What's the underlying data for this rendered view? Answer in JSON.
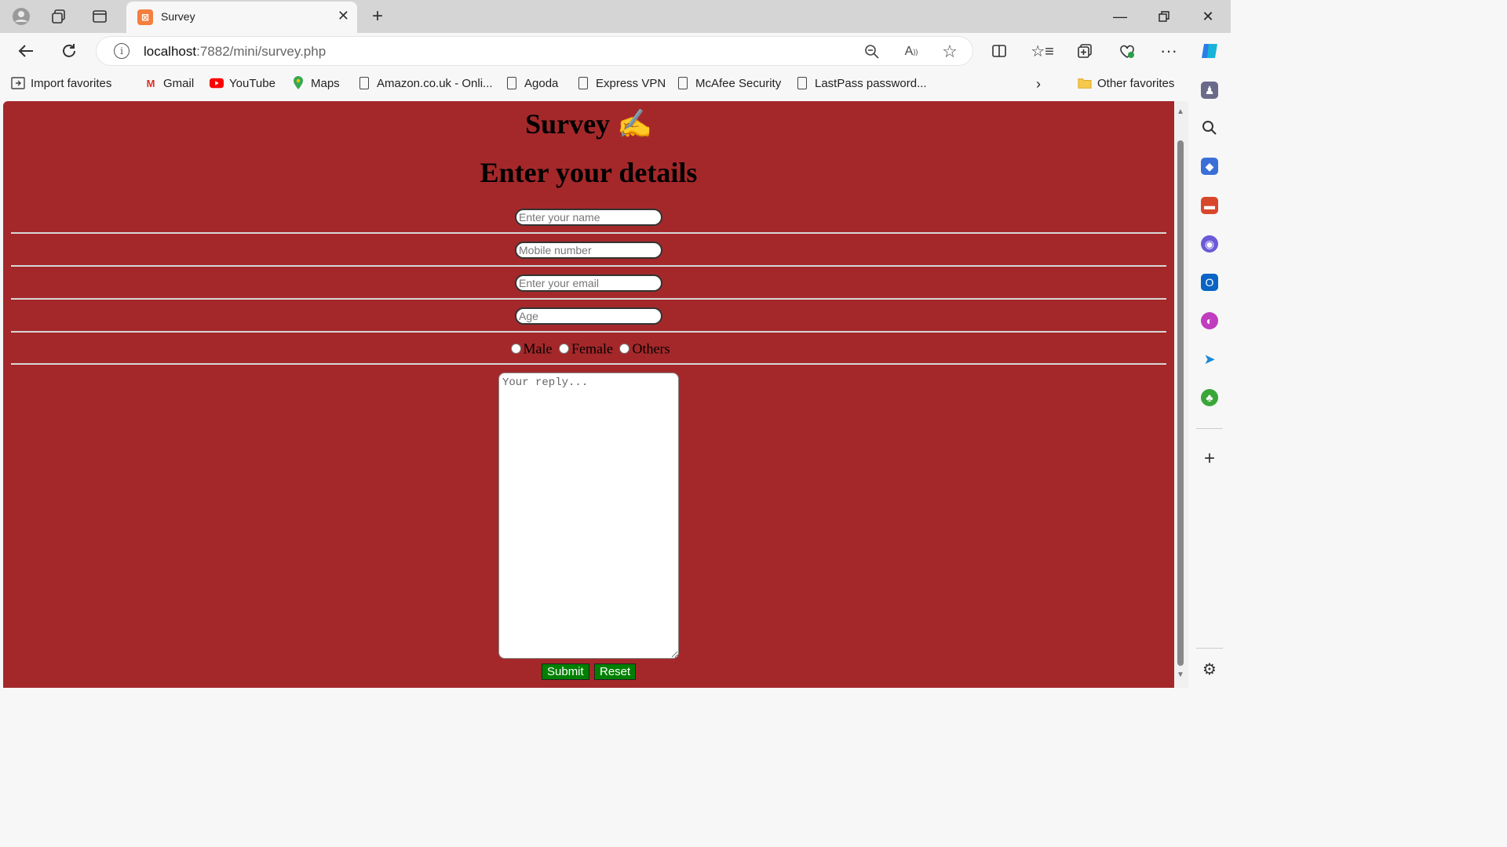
{
  "browser": {
    "tab": {
      "title": "Survey"
    },
    "address": {
      "host": "localhost",
      "rest": ":7882/mini/survey.php"
    },
    "favorites": [
      {
        "label": "Import favorites",
        "icon": "import-favorites-icon"
      },
      {
        "label": "Gmail",
        "icon": "gmail-icon"
      },
      {
        "label": "YouTube",
        "icon": "youtube-icon"
      },
      {
        "label": "Maps",
        "icon": "maps-icon"
      },
      {
        "label": "Amazon.co.uk - Onli...",
        "icon": "page-icon"
      },
      {
        "label": "Agoda",
        "icon": "page-icon"
      },
      {
        "label": "Express VPN",
        "icon": "page-icon"
      },
      {
        "label": "McAfee Security",
        "icon": "page-icon"
      },
      {
        "label": "LastPass password...",
        "icon": "page-icon"
      }
    ],
    "other_favorites": "Other favorites"
  },
  "page": {
    "title": "Survey",
    "title_emoji": "✍",
    "heading": "Enter your details",
    "fields": {
      "name_placeholder": "Enter your name",
      "mobile_placeholder": "Mobile number",
      "email_placeholder": "Enter your email",
      "age_placeholder": "Age"
    },
    "gender": {
      "male": "Male",
      "female": "Female",
      "others": "Others"
    },
    "reply_placeholder": "Your reply...",
    "submit_label": "Submit",
    "reset_label": "Reset",
    "colors": {
      "background": "#a4282a",
      "button": "#008000"
    }
  }
}
